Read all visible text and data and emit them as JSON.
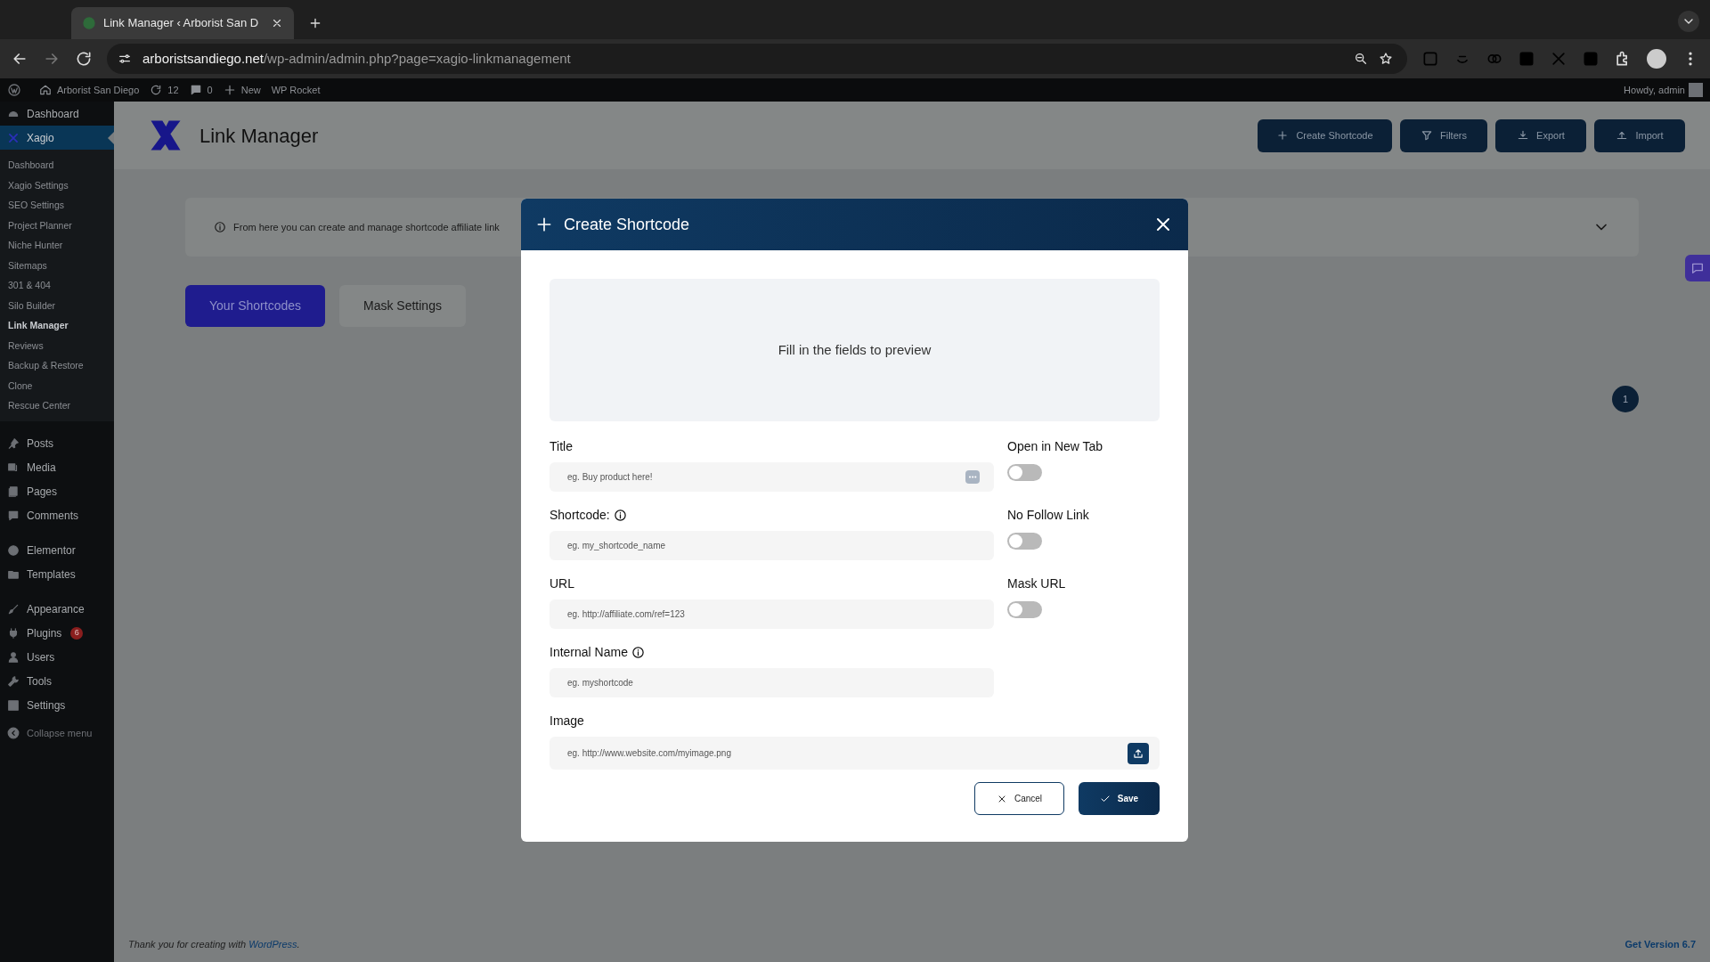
{
  "browser": {
    "tab_title": "Link Manager ‹ Arborist San D",
    "url_host": "arboristsandiego.net",
    "url_path": "/wp-admin/admin.php?page=xagio-linkmanagement"
  },
  "admin_bar": {
    "site": "Arborist San Diego",
    "updates": "12",
    "comments": "0",
    "new": "New",
    "plugin": "WP Rocket",
    "howdy": "Howdy, admin"
  },
  "sidebar": {
    "items": [
      {
        "label": "Dashboard",
        "selected": false
      },
      {
        "label": "Xagio",
        "selected": true,
        "children": [
          {
            "label": "Dashboard",
            "selected": false
          },
          {
            "label": "Xagio Settings",
            "selected": false
          },
          {
            "label": "SEO Settings",
            "selected": false
          },
          {
            "label": "Project Planner",
            "selected": false
          },
          {
            "label": "Niche Hunter",
            "selected": false
          },
          {
            "label": "Sitemaps",
            "selected": false
          },
          {
            "label": "301 & 404",
            "selected": false
          },
          {
            "label": "Silo Builder",
            "selected": false
          },
          {
            "label": "Link Manager",
            "selected": true
          },
          {
            "label": "Reviews",
            "selected": false
          },
          {
            "label": "Backup & Restore",
            "selected": false
          },
          {
            "label": "Clone",
            "selected": false
          },
          {
            "label": "Rescue Center",
            "selected": false
          }
        ]
      },
      {
        "label": "Posts",
        "selected": false
      },
      {
        "label": "Media",
        "selected": false
      },
      {
        "label": "Pages",
        "selected": false
      },
      {
        "label": "Comments",
        "selected": false
      },
      {
        "label": "Elementor",
        "selected": false
      },
      {
        "label": "Templates",
        "selected": false
      },
      {
        "label": "Appearance",
        "selected": false
      },
      {
        "label": "Plugins",
        "selected": false,
        "badge": "6"
      },
      {
        "label": "Users",
        "selected": false
      },
      {
        "label": "Tools",
        "selected": false
      },
      {
        "label": "Settings",
        "selected": false
      }
    ],
    "collapse": "Collapse menu"
  },
  "page": {
    "title": "Link Manager",
    "header_buttons": [
      "Create Shortcode",
      "Filters",
      "Export",
      "Import"
    ],
    "notice": "From here you can create and manage shortcode affiliate link",
    "tabs": [
      {
        "label": "Your Shortcodes",
        "selected": true
      },
      {
        "label": "Mask Settings",
        "selected": false
      }
    ],
    "pagination": [
      {
        "label": "1",
        "selected": true
      }
    ]
  },
  "modal": {
    "title": "Create Shortcode",
    "preview": "Fill in the fields to preview",
    "fields": [
      {
        "label": "Title",
        "info": false,
        "placeholder": "eg. Buy product here!",
        "kind": "text-menu"
      },
      {
        "label": "Shortcode:",
        "info": true,
        "placeholder": "eg. my_shortcode_name",
        "kind": "text"
      },
      {
        "label": "URL",
        "info": false,
        "placeholder": "eg. http://affiliate.com/ref=123",
        "kind": "text"
      },
      {
        "label": "Internal Name",
        "info": true,
        "placeholder": "eg. myshortcode",
        "kind": "text"
      }
    ],
    "toggles": [
      {
        "label": "Open in New Tab",
        "on": false
      },
      {
        "label": "No Follow Link",
        "on": false
      },
      {
        "label": "Mask URL",
        "on": false
      }
    ],
    "image": {
      "label": "Image",
      "placeholder": "eg. http://www.website.com/myimage.png"
    },
    "cancel": "Cancel",
    "save": "Save"
  },
  "footer": {
    "text": "Thank you for creating with ",
    "link": "WordPress",
    "end": ".",
    "version": "Get Version 6.7"
  }
}
